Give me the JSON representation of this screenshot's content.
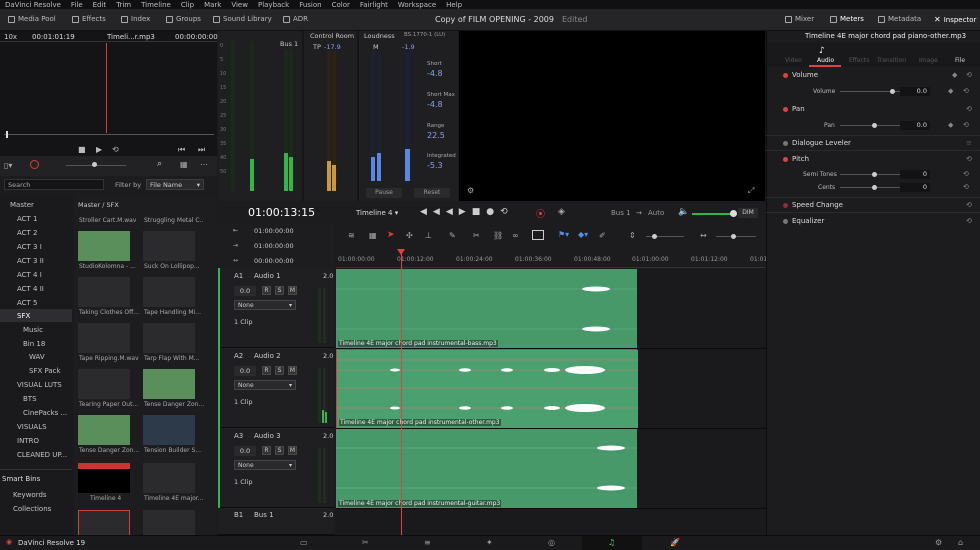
{
  "menu": [
    "DaVinci Resolve",
    "File",
    "Edit",
    "Trim",
    "Timeline",
    "Clip",
    "Mark",
    "View",
    "Playback",
    "Fusion",
    "Color",
    "Fairlight",
    "Workspace",
    "Help"
  ],
  "toolbar": {
    "media_pool": "Media Pool",
    "effects": "Effects",
    "index": "Index",
    "groups": "Groups",
    "sound_library": "Sound Library",
    "adr": "ADR",
    "project_title": "Copy of FILM OPENING - 2009",
    "edited": "Edited",
    "mixer": "Mixer",
    "meters": "Meters",
    "metadata": "Metadata",
    "inspector": "Inspector"
  },
  "viewer": {
    "zoom": "10x",
    "timecode_left": "00:01:01:19",
    "clip_name": "Timeli...r.mp3",
    "timecode_right": "00:00:00:00"
  },
  "meters": {
    "bus_label": "Bus 1",
    "control_room": "Control Room",
    "tp_label": "TP",
    "tp_value": "-17.9",
    "loudness": "Loudness",
    "standard": "BS.1770-1 (LU)",
    "m_label": "M",
    "m_value": "-1.9",
    "short_label": "Short",
    "short_value": "-4.8",
    "short_max_label": "Short Max",
    "short_max_value": "-4.8",
    "range_label": "Range",
    "range_value": "22.5",
    "integrated_label": "Integrated",
    "integrated_value": "-5.3",
    "pause": "Pause",
    "reset": "Reset",
    "scale": [
      "0",
      "5",
      "10",
      "15",
      "20",
      "25",
      "30",
      "35",
      "40",
      "50"
    ]
  },
  "bins": {
    "search_placeholder": "Search",
    "filter_by": "Filter by",
    "filter_value": "File Name",
    "items": [
      "Master",
      "ACT 1",
      "ACT 2",
      "ACT 3 I",
      "ACT 3 II",
      "ACT 4 I",
      "ACT 4 II",
      "ACT 5",
      "SFX",
      "Music",
      "Bin 18",
      "WAV",
      "SFX Pack",
      "VISUAL LUTS",
      "BTS",
      "CinePacks ...",
      "VISUALS",
      "INTRO",
      "CLEANED UP..."
    ],
    "smart_bins": "Smart Bins",
    "keywords": "Keywords",
    "collections": "Collections"
  },
  "media": {
    "path": "Master / SFX",
    "clips": [
      [
        "Stroller Cart.M.wav",
        "Struggling Metal C..."
      ],
      [
        "StudioKolomna - ...",
        "Suck On Lollipop..."
      ],
      [
        "Taking Clothes Off...",
        "Tape Handling Mi..."
      ],
      [
        "Tape Ripping.M.wav",
        "Tarp Flap With M..."
      ],
      [
        "Tearing Paper Out...",
        "Tense Danger Zon..."
      ],
      [
        "Tense Danger Zon...",
        "Tension Builder S..."
      ],
      [
        "Timeline 4",
        "Timeline 4E major..."
      ]
    ]
  },
  "timeline": {
    "timecode": "01:00:13:15",
    "name": "Timeline 4",
    "bus": "Bus 1",
    "mode": "Auto",
    "dim": "DIM",
    "tc_rows": [
      "01:00:00:00",
      "01:00:00:00",
      "00:00:00:00"
    ],
    "ruler": [
      "01:00:00:00",
      "01:00:12:00",
      "01:00:24:00",
      "01:00:36:00",
      "01:00:48:00",
      "01:01:00:00",
      "01:01:12:00",
      "01:01:"
    ],
    "tracks": [
      {
        "id": "A1",
        "name": "Audio 1",
        "ch": "2.0",
        "vol": "0.0",
        "routing": "None",
        "clips": "1 Clip",
        "clip_name": "Timeline 4E major chord pad instrumental-bass.mp3"
      },
      {
        "id": "A2",
        "name": "Audio 2",
        "ch": "2.0",
        "vol": "0.0",
        "routing": "None",
        "clips": "1 Clip",
        "clip_name": "Timeline 4E major chord pad instrumental-other.mp3"
      },
      {
        "id": "A3",
        "name": "Audio 3",
        "ch": "2.0",
        "vol": "0.0",
        "routing": "None",
        "clips": "1 Clip",
        "clip_name": "Timeline 4E major chord pad instrumental-guitar.mp3"
      }
    ],
    "bus_track": {
      "id": "B1",
      "name": "Bus 1",
      "ch": "2.0"
    }
  },
  "inspector": {
    "title": "Timeline 4E major chord pad piano-other.mp3",
    "tabs": [
      "Video",
      "Audio",
      "Effects",
      "Transition",
      "Image",
      "File"
    ],
    "active_tab": "Audio",
    "volume": "Volume",
    "volume_param": "Volume",
    "volume_value": "0.0",
    "pan": "Pan",
    "pan_param": "Pan",
    "pan_value": "0.0",
    "dialogue": "Dialogue Leveler",
    "pitch": "Pitch",
    "semi_tones": "Semi Tones",
    "semi_value": "0",
    "cents": "Cents",
    "cents_value": "0",
    "speed": "Speed Change",
    "equalizer": "Equalizer"
  },
  "footer": {
    "app": "DaVinci Resolve 19"
  },
  "colors": {
    "accent": "#e64040",
    "clip_green": "#47996a",
    "meter_green": "#2fb84a",
    "meter_blue": "#5b87e0",
    "meter_amber": "#c89a3a"
  }
}
